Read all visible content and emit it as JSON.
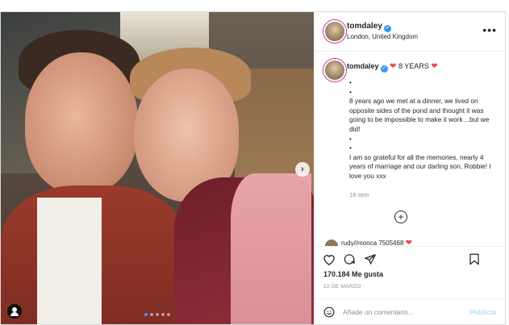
{
  "post": {
    "username": "tomdaley",
    "location": "London, United Kingdom",
    "caption_title": "8 YEARS",
    "caption_body": "•\n•\n8 years ago we met at a dinner, we lived on opposite sides of the pond and thought it was going to be impossible to make it work…but we did!\n•\n•\nI am so grateful for all the memories, nearly 4 years of marriage and our darling son, Robbie! I love you xxx",
    "time_ago": "18 sem",
    "next_commenter": "rudy//monca 7505468",
    "likes": "170.184 Me gusta",
    "date": "22 DE MARZO",
    "comment_placeholder": "Añade un comentario...",
    "publish_label": "Publicar"
  },
  "icons": {
    "more": "more-options-icon",
    "like": "heart-icon",
    "comment": "comment-icon",
    "share": "share-icon",
    "save": "bookmark-icon",
    "emoji": "emoji-icon",
    "add": "add-circle-icon",
    "next": "chevron-right-icon",
    "tag": "user-tag-icon"
  },
  "colors": {
    "accent": "#3897f0",
    "heart": "#ed4956",
    "publish_disabled": "#b2dffc"
  },
  "carousel": {
    "count": 5,
    "active_index": 0
  }
}
